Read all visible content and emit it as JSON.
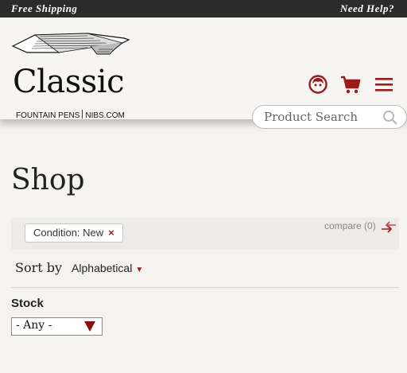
{
  "topbar": {
    "left_text": "Free Shipping",
    "right_text": "Need Help?"
  },
  "logo": {
    "wordmark": "Classic",
    "tagline_left": "FOUNTAIN PENS",
    "tagline_right": "NIBS.COM"
  },
  "header_icons": [
    "account-icon",
    "cart-icon",
    "menu-icon"
  ],
  "search": {
    "placeholder": "Product Search"
  },
  "page": {
    "title": "Shop"
  },
  "filters": {
    "active_chip": "Condition: New",
    "remove_glyph": "×"
  },
  "compare": {
    "label": "compare (0)"
  },
  "sort": {
    "label": "Sort by",
    "value": "Alphabetical",
    "caret": "▼"
  },
  "stock": {
    "label": "Stock",
    "value": "- Any -"
  },
  "colors": {
    "accent": "#9b1b1b",
    "topbar": "#2b2b2b",
    "background": "#f4f3f0"
  }
}
